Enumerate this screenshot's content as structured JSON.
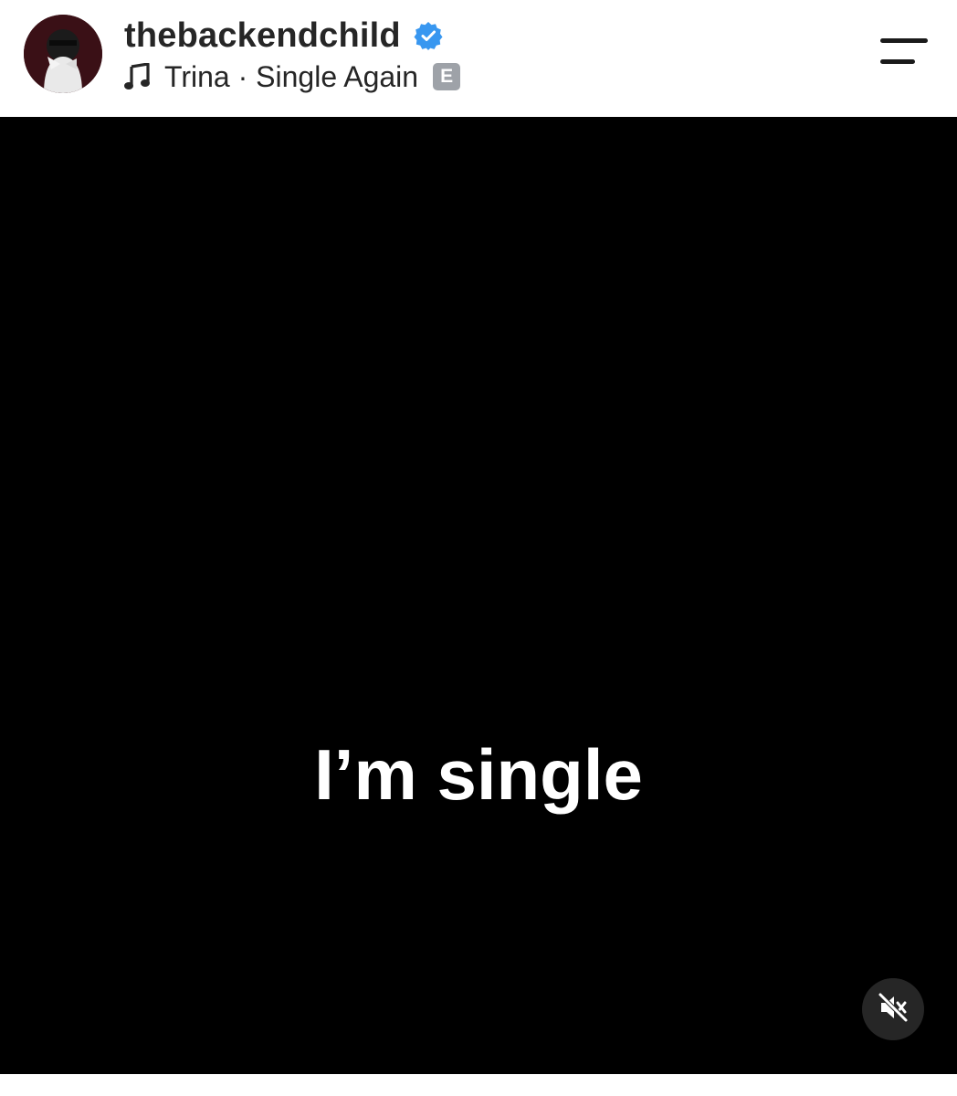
{
  "post_header": {
    "username": "thebackendchild",
    "verified": true,
    "avatar_icon": "profile-avatar",
    "music": {
      "icon": "music-note-icon",
      "artist": "Trina",
      "separator": "·",
      "song": "Single Again",
      "label": "Trina · Single Again",
      "explicit_badge": "E"
    },
    "menu_icon": "menu-icon"
  },
  "video": {
    "caption": "I’m single",
    "background_color": "#000000",
    "mute_icon": "speaker-muted-icon"
  },
  "colors": {
    "verified_blue": "#3897f0",
    "text": "#262626",
    "explicit_badge_bg": "#9ea2a8"
  }
}
